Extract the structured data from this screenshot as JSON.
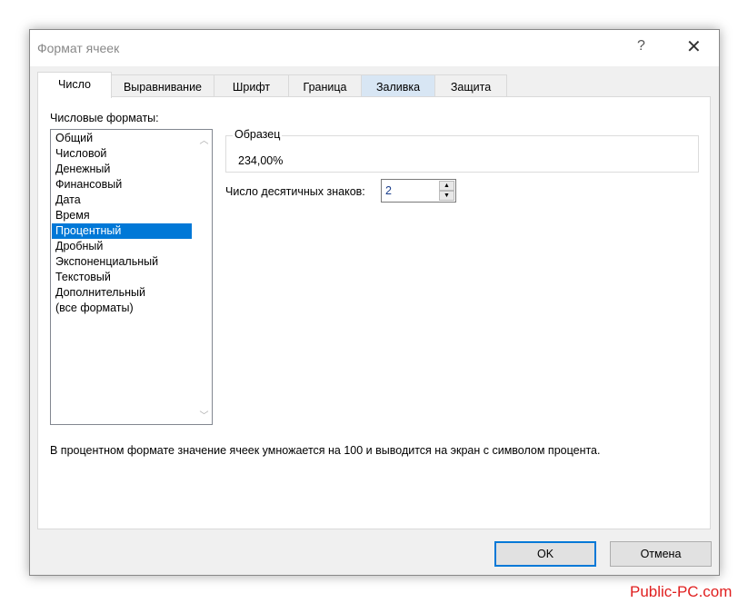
{
  "window": {
    "title": "Формат ячеек",
    "help": "?",
    "close": "✕"
  },
  "tabs": [
    "Число",
    "Выравнивание",
    "Шрифт",
    "Граница",
    "Заливка",
    "Защита"
  ],
  "formats_label": "Числовые форматы:",
  "formats": [
    "Общий",
    "Числовой",
    "Денежный",
    "Финансовый",
    "Дата",
    "Время",
    "Процентный",
    "Дробный",
    "Экспоненциальный",
    "Текстовый",
    "Дополнительный",
    "(все форматы)"
  ],
  "selected_format": "Процентный",
  "sample": {
    "label": "Образец",
    "value": "234,00%"
  },
  "decimals": {
    "label": "Число десятичных знаков:",
    "value": "2"
  },
  "description": "В процентном формате значение ячеек умножается на 100 и выводится на экран с символом процента.",
  "buttons": {
    "ok": "OK",
    "cancel": "Отмена"
  },
  "watermark": "Public-PC.com",
  "colors": {
    "selection": "#0078d7",
    "watermark": "#e02020"
  }
}
